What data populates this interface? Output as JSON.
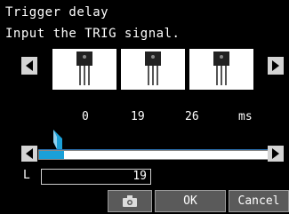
{
  "header": {
    "title": "Trigger delay",
    "subtitle": "Input the TRIG signal."
  },
  "frames": {
    "times": [
      "0",
      "19",
      "26"
    ],
    "unit": "ms",
    "icon": "transistor-thumbnail"
  },
  "slider": {
    "position_fraction": 0.11,
    "accent_color": "#1aa0d8"
  },
  "value_field": {
    "label": "L",
    "value": "19"
  },
  "buttons": {
    "camera_icon": "camera-icon",
    "ok_label": "OK",
    "cancel_label": "Cancel"
  }
}
